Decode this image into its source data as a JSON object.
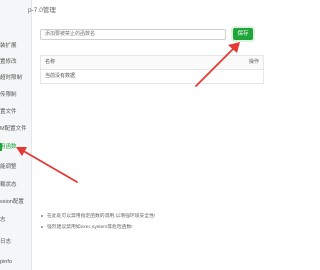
{
  "header": {
    "title": "p-7.0管理"
  },
  "sidebar": {
    "items": [
      {
        "label": "装扩展",
        "active": false
      },
      {
        "label": "置修改",
        "active": false
      },
      {
        "label": "超时限制",
        "active": false
      },
      {
        "label": "传限制",
        "active": false
      },
      {
        "label": "置文件",
        "active": false
      },
      {
        "label": "M配置文件",
        "active": false
      },
      {
        "label": "用函数",
        "active": true
      },
      {
        "label": "能调整",
        "active": false
      },
      {
        "label": "载状态",
        "active": false
      },
      {
        "label": "ssion配置",
        "active": false
      },
      {
        "label": "志",
        "active": false
      },
      {
        "label": "日志",
        "active": false
      },
      {
        "label": "pinfo",
        "active": false
      }
    ]
  },
  "form": {
    "placeholder": "添加要被禁止的函数名",
    "save_label": "保存"
  },
  "table": {
    "headers": {
      "name": "名称",
      "actions": "操作"
    },
    "empty_text": "当前没有数据"
  },
  "tips": [
    "在此处可以禁用指定函数的调用,以增强环境安全性!",
    "强烈建议禁用如exec,system等危险函数!"
  ],
  "colors": {
    "accent": "#20a53a",
    "annotation": "#e53935"
  }
}
